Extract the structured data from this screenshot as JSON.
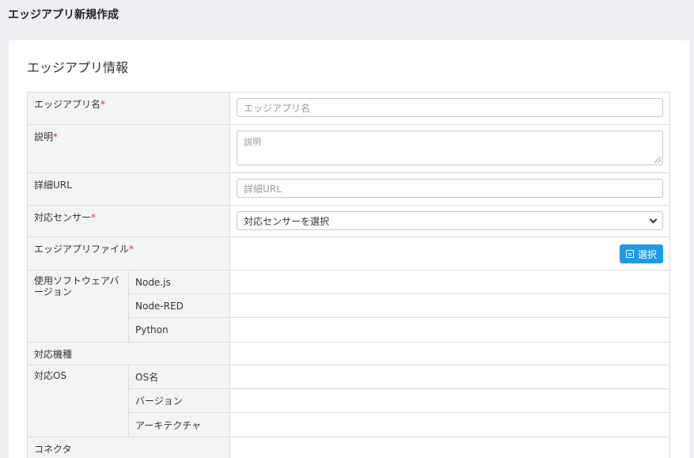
{
  "page": {
    "title": "エッジアプリ新規作成"
  },
  "section": {
    "title": "エッジアプリ情報"
  },
  "form": {
    "name": {
      "label": "エッジアプリ名",
      "required_mark": "*",
      "placeholder": "エッジアプリ名"
    },
    "description": {
      "label": "説明",
      "required_mark": "*",
      "placeholder": "説明"
    },
    "detail_url": {
      "label": "詳細URL",
      "placeholder": "詳細URL"
    },
    "sensor": {
      "label": "対応センサー",
      "required_mark": "*",
      "selected": "対応センサーを選択"
    },
    "file": {
      "label": "エッジアプリファイル",
      "required_mark": "*",
      "button_label": "選択",
      "button_icon": "document-icon"
    },
    "software": {
      "label": "使用ソフトウェアバージョン",
      "items": [
        "Node.js",
        "Node-RED",
        "Python"
      ]
    },
    "device": {
      "label": "対応機種"
    },
    "os": {
      "label": "対応OS",
      "items": [
        "OS名",
        "バージョン",
        "アーキテクチャ"
      ]
    },
    "connector": {
      "label": "コネクタ"
    }
  },
  "colors": {
    "accent": "#1e9be8",
    "required": "#e0303a",
    "label_bg": "#f3f4f6",
    "border": "#dcdcdc"
  }
}
